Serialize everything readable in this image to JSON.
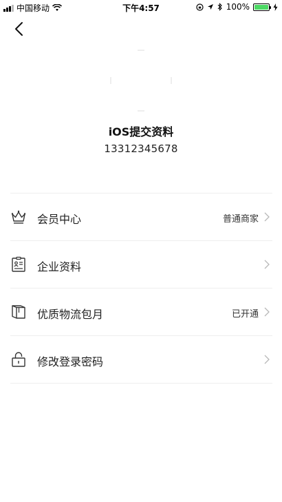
{
  "status_bar": {
    "carrier": "中国移动",
    "time": "下午4:57",
    "battery": "100%"
  },
  "profile": {
    "name": "iOS提交资料",
    "phone": "13312345678"
  },
  "menu": [
    {
      "label": "会员中心",
      "value": "普通商家",
      "icon": "crown-icon"
    },
    {
      "label": "企业资料",
      "value": "",
      "icon": "id-card-icon"
    },
    {
      "label": "优质物流包月",
      "value": "已开通",
      "icon": "package-icon"
    },
    {
      "label": "修改登录密码",
      "value": "",
      "icon": "lock-icon"
    }
  ],
  "colors": {
    "battery": "#4cd964",
    "divider": "#eeeeee",
    "chevron": "#b8b8b8"
  }
}
